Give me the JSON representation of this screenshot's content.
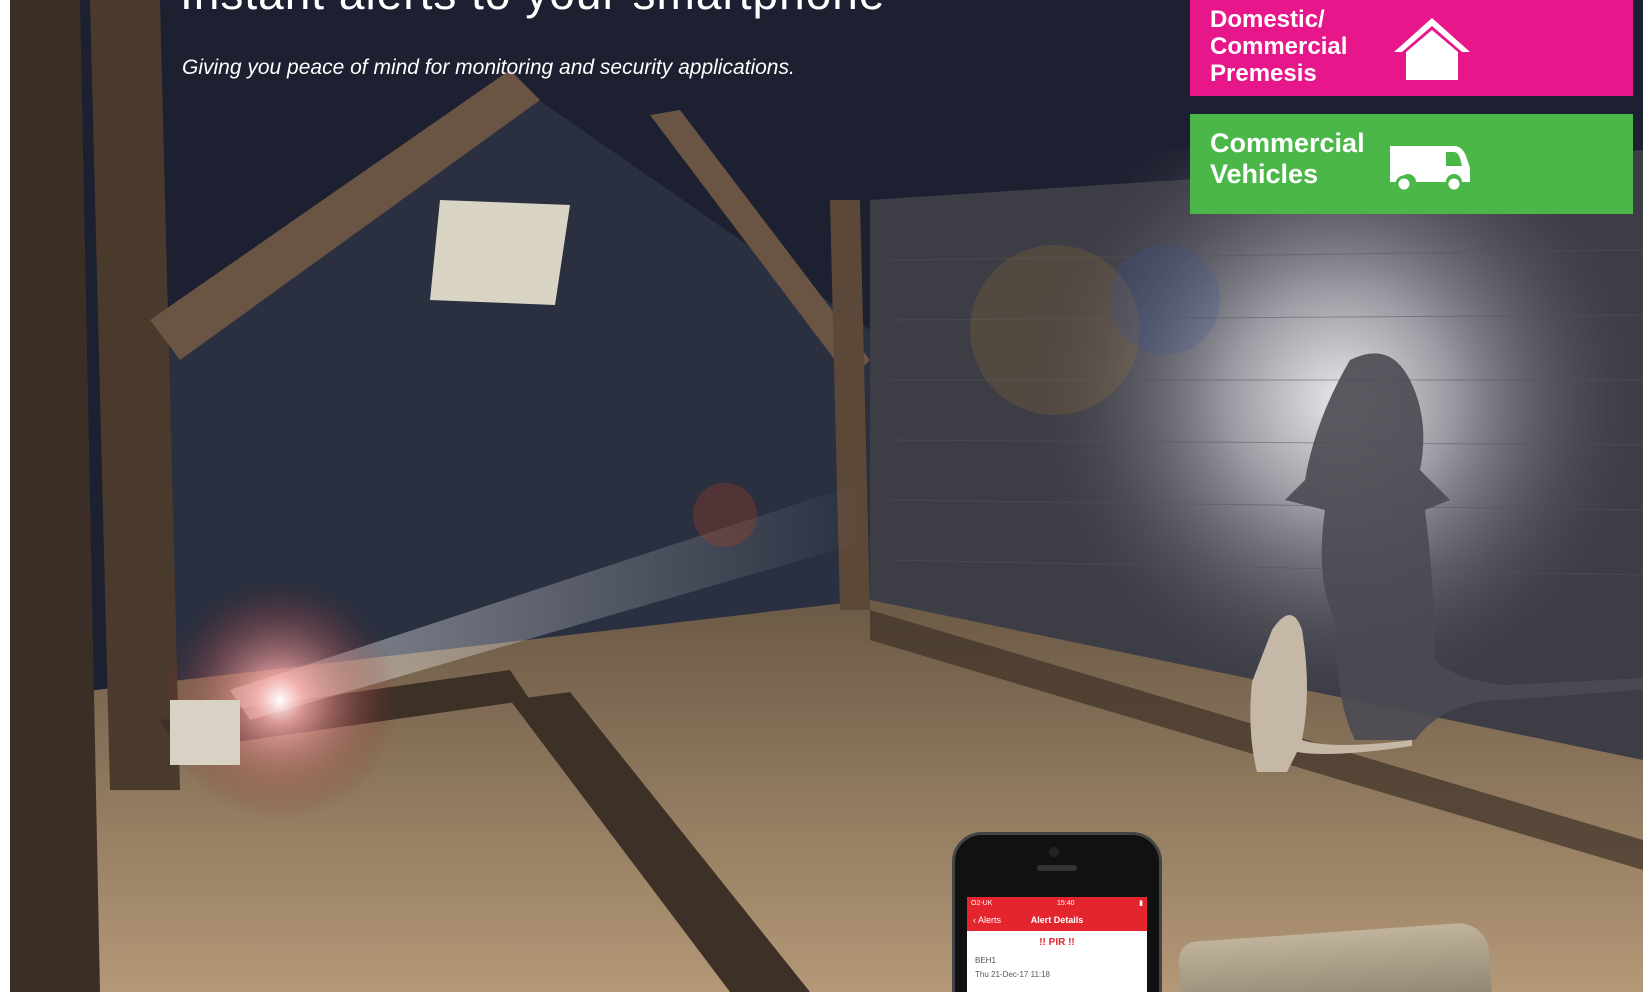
{
  "headline": "Instant alerts to your smartphone",
  "tagline": "Giving you peace of mind for monitoring and security applications.",
  "badges": {
    "domestic": {
      "label_line1": "Domestic/",
      "label_line2": "Commercial",
      "label_line3": "Premesis",
      "color": "#e8168b",
      "icon": "house-icon"
    },
    "vehicles": {
      "label_line1": "Commercial",
      "label_line2": "Vehicles",
      "color": "#4cb749",
      "icon": "van-icon"
    }
  },
  "phone": {
    "carrier": "O2-UK",
    "time": "15:40",
    "back_label": "Alerts",
    "screen_title": "Alert Details",
    "alert_text": "!! PIR !!",
    "device_id": "BEH1",
    "timestamp": "Thu 21-Dec-17 11:18"
  }
}
